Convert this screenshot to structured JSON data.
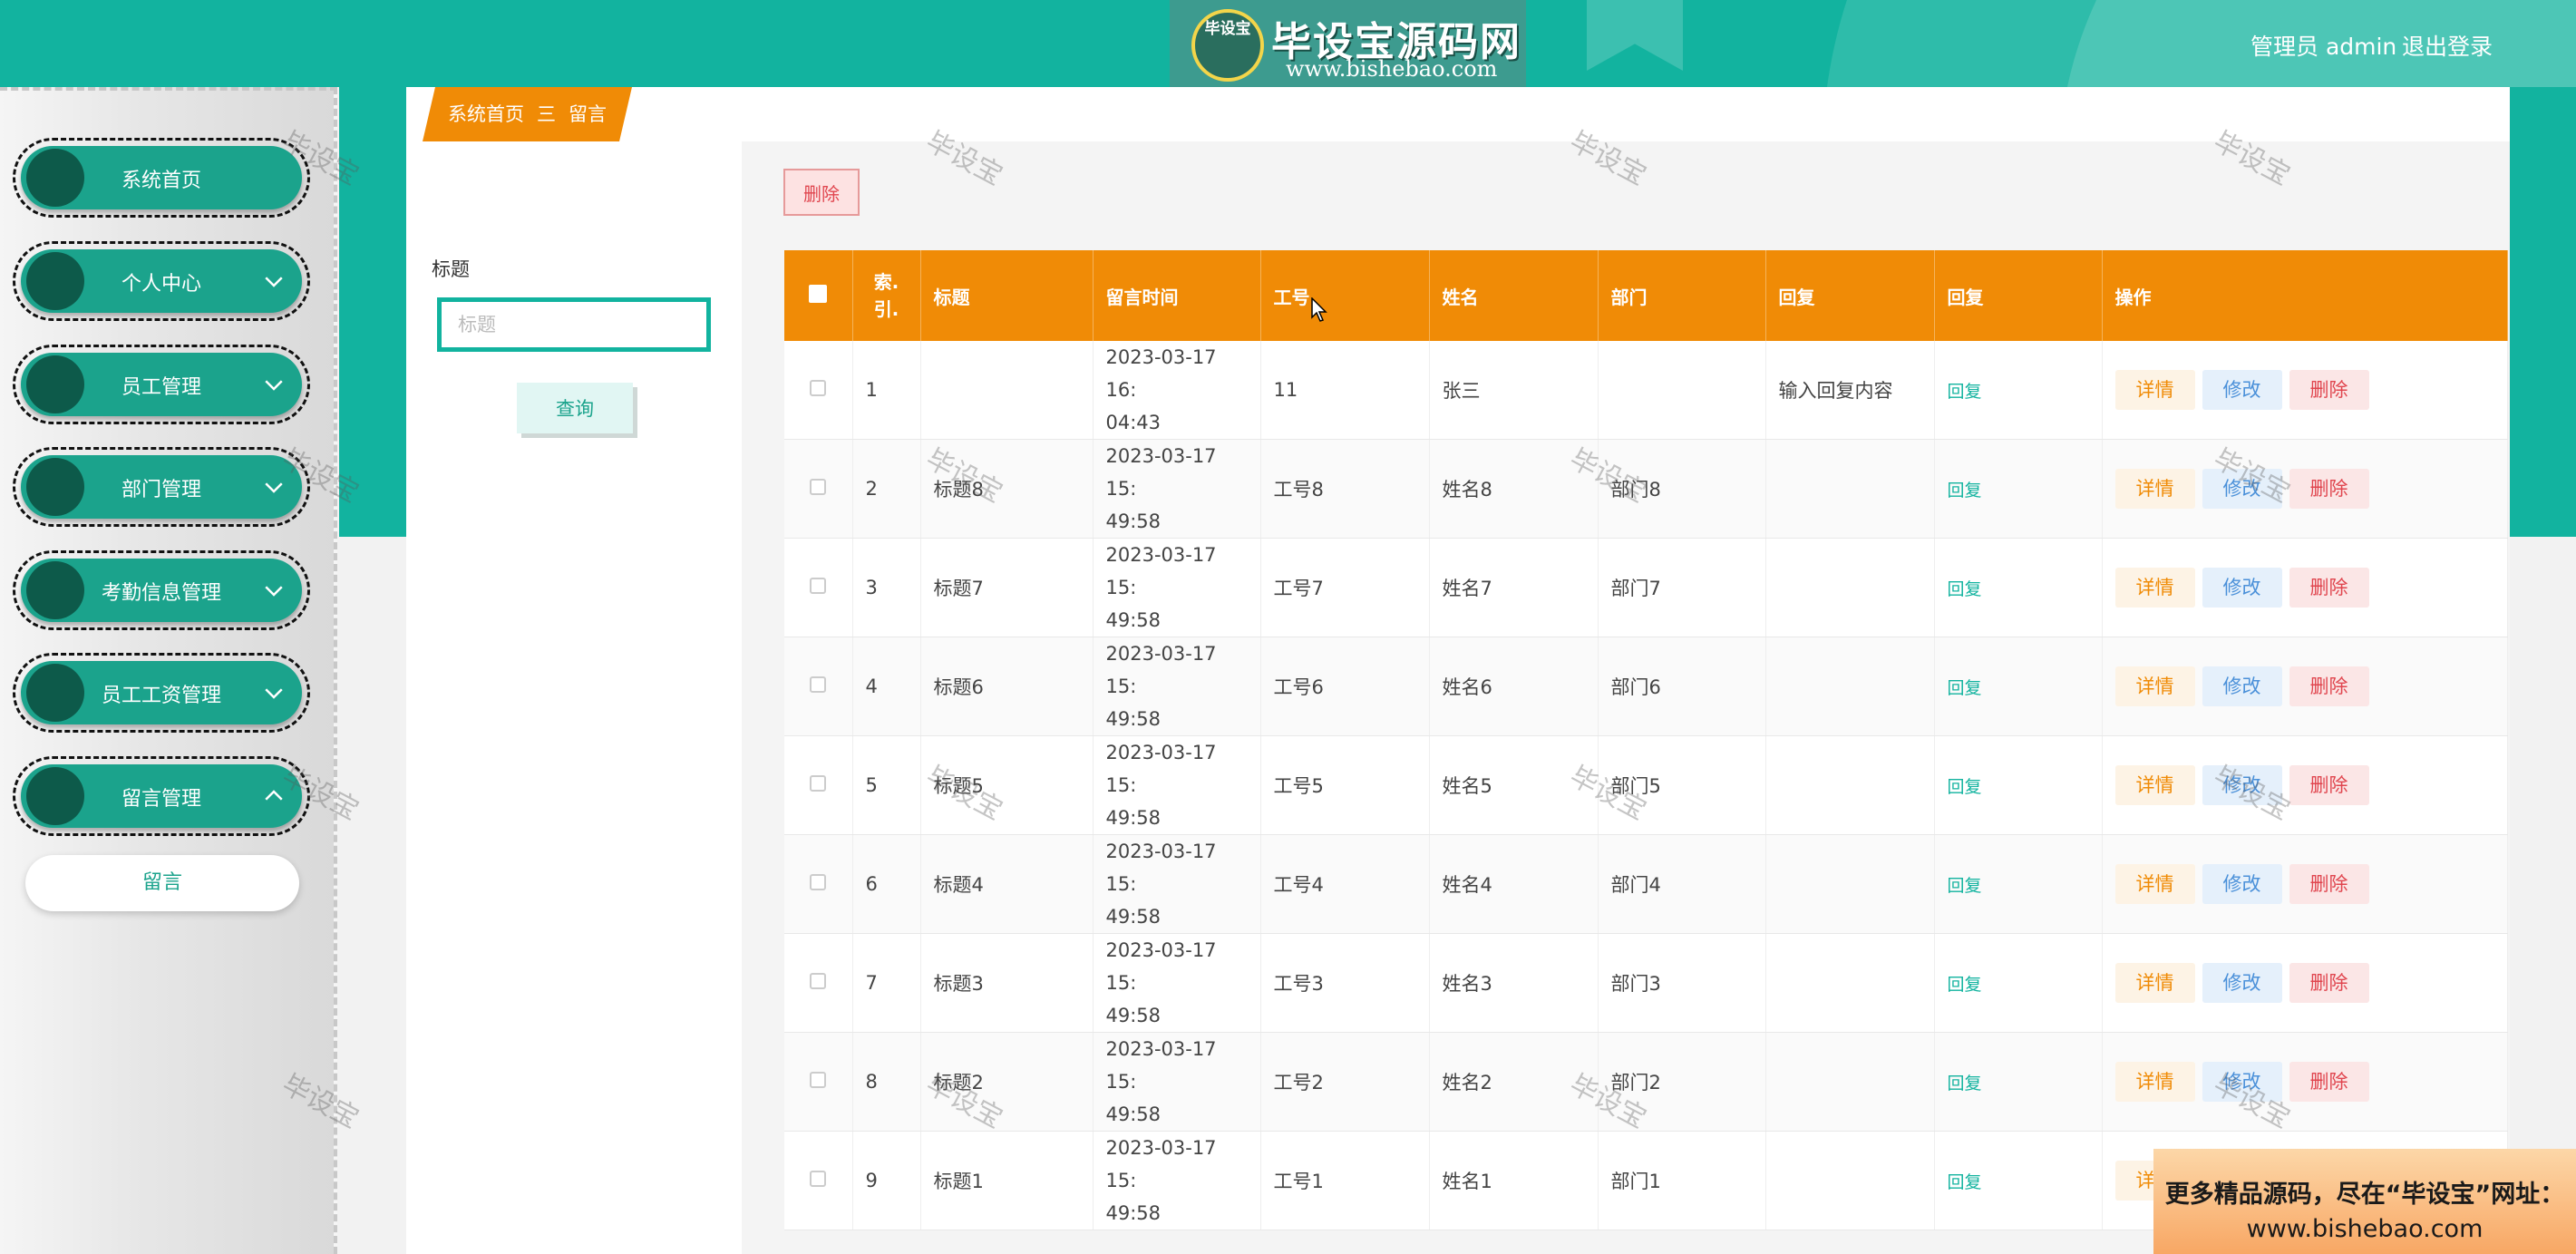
{
  "header": {
    "logo_badge": "毕设宝",
    "logo_title": "毕设宝源码网",
    "logo_url": "www.bishebao.com",
    "user_label": "管理员 admin",
    "logout": "退出登录"
  },
  "sidebar": {
    "items": [
      {
        "label": "系统首页",
        "has_chevron": false
      },
      {
        "label": "个人中心",
        "has_chevron": true
      },
      {
        "label": "员工管理",
        "has_chevron": true
      },
      {
        "label": "部门管理",
        "has_chevron": true
      },
      {
        "label": "考勤信息管理",
        "has_chevron": true
      },
      {
        "label": "员工工资管理",
        "has_chevron": true
      },
      {
        "label": "留言管理",
        "has_chevron": true,
        "expanded": true
      }
    ],
    "submenu": {
      "label": "留言"
    }
  },
  "breadcrumb": {
    "home": "系统首页",
    "separator": "三",
    "current": "留言"
  },
  "search": {
    "label": "标题",
    "placeholder": "标题",
    "value": "",
    "query_button": "查询"
  },
  "toolbar": {
    "delete_label": "删除"
  },
  "table": {
    "headers": [
      "索引",
      "标题",
      "留言时间",
      "工号",
      "姓名",
      "部门",
      "回复",
      "回复",
      "操作"
    ],
    "index_header_lines": [
      "索.",
      "引."
    ],
    "rows": [
      {
        "index": "1",
        "title": "",
        "time_line1": "2023-03-17 16:",
        "time_line2": "04:43",
        "emp_no": "11",
        "name": "张三",
        "dept": "",
        "reply": "输入回复内容",
        "reply_link": "回复"
      },
      {
        "index": "2",
        "title": "标题8",
        "time_line1": "2023-03-17 15:",
        "time_line2": "49:58",
        "emp_no": "工号8",
        "name": "姓名8",
        "dept": "部门8",
        "reply": "",
        "reply_link": "回复"
      },
      {
        "index": "3",
        "title": "标题7",
        "time_line1": "2023-03-17 15:",
        "time_line2": "49:58",
        "emp_no": "工号7",
        "name": "姓名7",
        "dept": "部门7",
        "reply": "",
        "reply_link": "回复"
      },
      {
        "index": "4",
        "title": "标题6",
        "time_line1": "2023-03-17 15:",
        "time_line2": "49:58",
        "emp_no": "工号6",
        "name": "姓名6",
        "dept": "部门6",
        "reply": "",
        "reply_link": "回复"
      },
      {
        "index": "5",
        "title": "标题5",
        "time_line1": "2023-03-17 15:",
        "time_line2": "49:58",
        "emp_no": "工号5",
        "name": "姓名5",
        "dept": "部门5",
        "reply": "",
        "reply_link": "回复"
      },
      {
        "index": "6",
        "title": "标题4",
        "time_line1": "2023-03-17 15:",
        "time_line2": "49:58",
        "emp_no": "工号4",
        "name": "姓名4",
        "dept": "部门4",
        "reply": "",
        "reply_link": "回复"
      },
      {
        "index": "7",
        "title": "标题3",
        "time_line1": "2023-03-17 15:",
        "time_line2": "49:58",
        "emp_no": "工号3",
        "name": "姓名3",
        "dept": "部门3",
        "reply": "",
        "reply_link": "回复"
      },
      {
        "index": "8",
        "title": "标题2",
        "time_line1": "2023-03-17 15:",
        "time_line2": "49:58",
        "emp_no": "工号2",
        "name": "姓名2",
        "dept": "部门2",
        "reply": "",
        "reply_link": "回复"
      },
      {
        "index": "9",
        "title": "标题1",
        "time_line1": "2023-03-17 15:",
        "time_line2": "49:58",
        "emp_no": "工号1",
        "name": "姓名1",
        "dept": "部门1",
        "reply": "",
        "reply_link": "回复"
      }
    ],
    "actions": {
      "detail": "详情",
      "edit": "修改",
      "delete": "删除"
    }
  },
  "watermark": "毕设宝",
  "ad": {
    "line1": "更多精品源码，尽在“毕设宝”网址：",
    "line2": "www.bishebao.com"
  },
  "colors": {
    "primary": "#12b39f",
    "accent_orange": "#f08b06",
    "danger": "#e0454e",
    "info": "#4a90d9"
  }
}
